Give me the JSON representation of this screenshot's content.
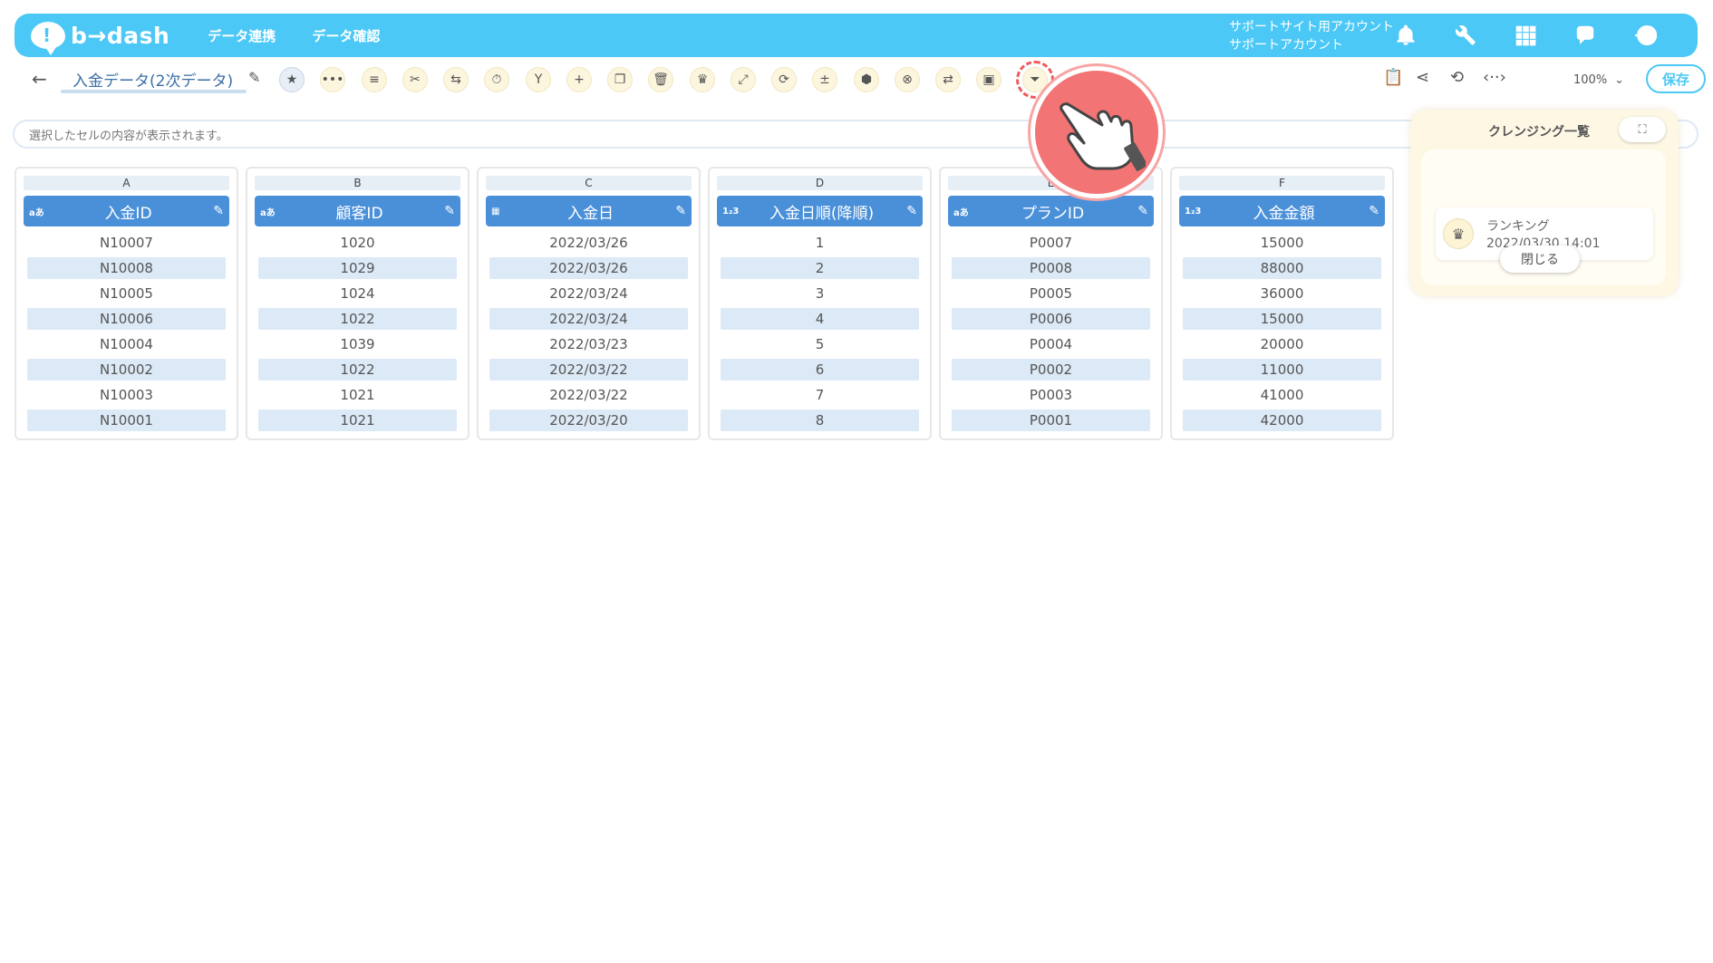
{
  "app": {
    "logo_text": "b→dash"
  },
  "nav": {
    "links": [
      "データ連携",
      "データ確認"
    ],
    "account_line1": "サポートサイト用アカウント",
    "account_line2": "サポートアカウント",
    "icons": [
      "bell-icon",
      "wrench-icon",
      "grid-icon",
      "chat-bubble-icon",
      "logout-icon"
    ]
  },
  "toolbar": {
    "title": "入金データ(2次データ)",
    "zoom": "100%",
    "save_label": "保存",
    "tools": [
      "star-icon",
      "more-icon",
      "list-icon",
      "scissors-icon",
      "merge-icon",
      "timer-icon",
      "branch-icon",
      "plus-icon",
      "copy-icon",
      "trash-icon",
      "crown-icon",
      "expand-icon",
      "repeat-icon",
      "calc-icon",
      "bag-icon",
      "cancel-icon",
      "convert-icon",
      "box-icon",
      "filter-icon"
    ],
    "right_tools": [
      "clipboard-icon",
      "share-icon",
      "refresh-icon",
      "code-icon"
    ]
  },
  "cell_bar": {
    "placeholder": "選択したセルの内容が表示されます。"
  },
  "columns": [
    {
      "letter": "A",
      "type": "aあ",
      "name": "入金ID",
      "values": [
        "N10007",
        "N10008",
        "N10005",
        "N10006",
        "N10004",
        "N10002",
        "N10003",
        "N10001"
      ]
    },
    {
      "letter": "B",
      "type": "aあ",
      "name": "顧客ID",
      "values": [
        "1020",
        "1029",
        "1024",
        "1022",
        "1039",
        "1022",
        "1021",
        "1021"
      ]
    },
    {
      "letter": "C",
      "type": "calendar",
      "name": "入金日",
      "values": [
        "2022/03/26",
        "2022/03/26",
        "2022/03/24",
        "2022/03/24",
        "2022/03/23",
        "2022/03/22",
        "2022/03/22",
        "2022/03/20"
      ]
    },
    {
      "letter": "D",
      "type": "1₂3",
      "name": "入金日順(降順)",
      "values": [
        "1",
        "2",
        "3",
        "4",
        "5",
        "6",
        "7",
        "8"
      ]
    },
    {
      "letter": "E",
      "type": "aあ",
      "name": "プランID",
      "values": [
        "P0007",
        "P0008",
        "P0005",
        "P0006",
        "P0004",
        "P0002",
        "P0003",
        "P0001"
      ]
    },
    {
      "letter": "F",
      "type": "1₂3",
      "name": "入金金額",
      "values": [
        "15000",
        "88000",
        "36000",
        "15000",
        "20000",
        "11000",
        "41000",
        "42000"
      ]
    }
  ],
  "cleansing": {
    "title": "クレンジング一覧",
    "item_name": "ランキング",
    "item_time": "2022/03/30 14:01",
    "close_label": "閉じる"
  }
}
